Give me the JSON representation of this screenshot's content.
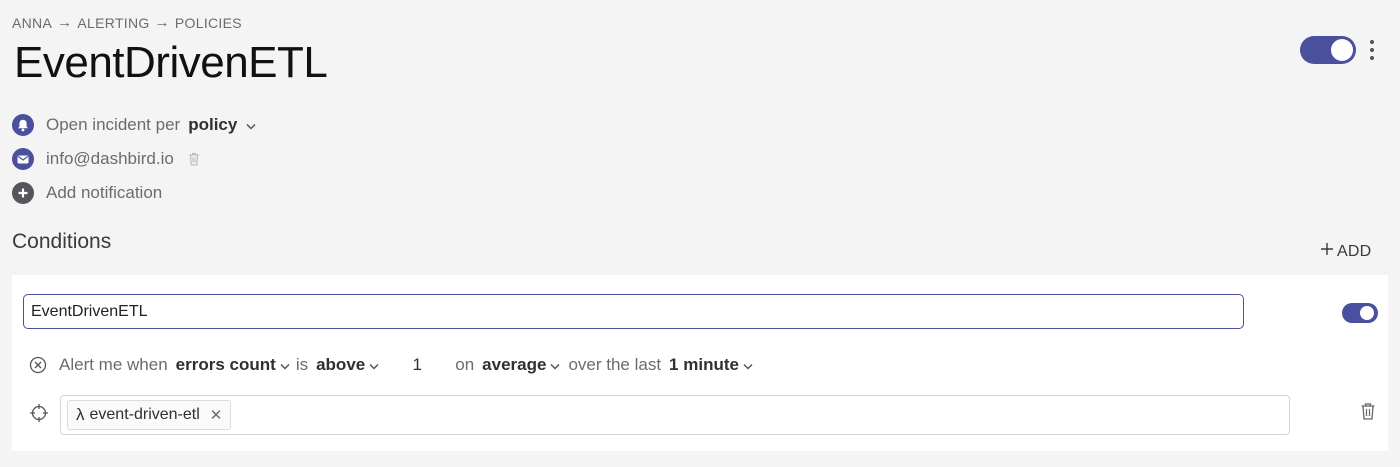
{
  "breadcrumb": {
    "items": [
      "ANNA",
      "ALERTING",
      "POLICIES"
    ],
    "separator": "→"
  },
  "page": {
    "title": "EventDrivenETL"
  },
  "policy_toggle": {
    "enabled": true
  },
  "notifications": {
    "incident": {
      "prefix": "Open incident per",
      "value": "policy"
    },
    "email": {
      "address": "info@dashbird.io"
    },
    "add_label": "Add notification"
  },
  "conditions": {
    "title": "Conditions",
    "add_label": "ADD",
    "items": [
      {
        "name": "EventDrivenETL",
        "enabled": true,
        "rule": {
          "prefix": "Alert me when",
          "metric": "errors count",
          "is_label": "is",
          "comparator": "above",
          "threshold": "1",
          "on_label": "on",
          "aggregation": "average",
          "over_label": "over the last",
          "window": "1 minute"
        },
        "targets": [
          {
            "name": "event-driven-etl",
            "icon": "lambda-icon"
          }
        ]
      }
    ]
  },
  "colors": {
    "accent": "#4a4f9e",
    "background": "#f4f4f5",
    "card": "#ffffff"
  }
}
